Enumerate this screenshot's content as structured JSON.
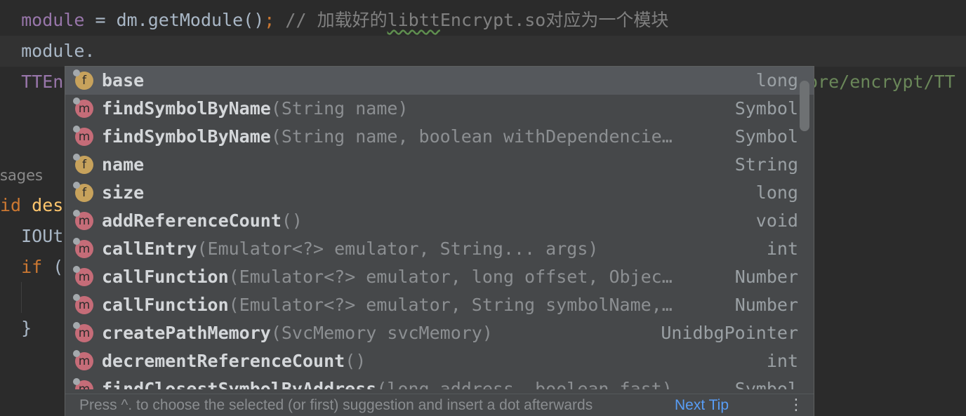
{
  "editor": {
    "line1": {
      "var": "module",
      "op": " = ",
      "call": "dm.getModule()",
      "semicolon": ";",
      "comment_a": " // 加载好的",
      "comment_lib": "libtt",
      "comment_b": "Encrypt.so对应为一个模块"
    },
    "line2": {
      "text": "module."
    },
    "line3": {
      "prefix": "TTEn",
      "right_text": "ore/encrypt/TT"
    },
    "line5": {
      "text": "sages"
    },
    "line6": {
      "kw": "id",
      "rest": " des"
    },
    "line7": {
      "text": "IOUt"
    },
    "line8": {
      "kw": "if",
      "rest": " ("
    },
    "line10": {
      "text": "}"
    }
  },
  "popup": {
    "items": [
      {
        "kind": "f",
        "name": "base",
        "params": "",
        "type": "long",
        "selected": true
      },
      {
        "kind": "m",
        "name": "findSymbolByName",
        "params": "(String name)",
        "type": "Symbol"
      },
      {
        "kind": "m",
        "name": "findSymbolByName",
        "params": "(String name, boolean withDependencie…",
        "type": "Symbol"
      },
      {
        "kind": "f",
        "name": "name",
        "params": "",
        "type": "String"
      },
      {
        "kind": "f",
        "name": "size",
        "params": "",
        "type": "long"
      },
      {
        "kind": "m",
        "name": "addReferenceCount",
        "params": "()",
        "type": "void"
      },
      {
        "kind": "m",
        "name": "callEntry",
        "params": "(Emulator<?> emulator, String... args)",
        "type": "int"
      },
      {
        "kind": "m",
        "name": "callFunction",
        "params": "(Emulator<?> emulator, long offset, Objec…",
        "type": "Number"
      },
      {
        "kind": "m",
        "name": "callFunction",
        "params": "(Emulator<?> emulator, String symbolName,…",
        "type": "Number"
      },
      {
        "kind": "m",
        "name": "createPathMemory",
        "params": "(SvcMemory svcMemory)",
        "type": "UnidbgPointer"
      },
      {
        "kind": "m",
        "name": "decrementReferenceCount",
        "params": "()",
        "type": "int"
      },
      {
        "kind": "m",
        "name": "findClosestSymbolByAddress",
        "params": "(long address, boolean fast)",
        "type": "Symbol"
      }
    ],
    "footer": {
      "hint": "Press ^. to choose the selected (or first) suggestion and insert a dot afterwards",
      "next_tip": "Next Tip",
      "more_icon": "vertical-ellipsis-icon"
    }
  },
  "colors": {
    "background": "#2b2b2b",
    "popup_bg": "#46484a",
    "field_icon": "#c7a25c",
    "method_icon": "#c56c78",
    "keyword": "#cc7832",
    "link": "#589df6"
  }
}
